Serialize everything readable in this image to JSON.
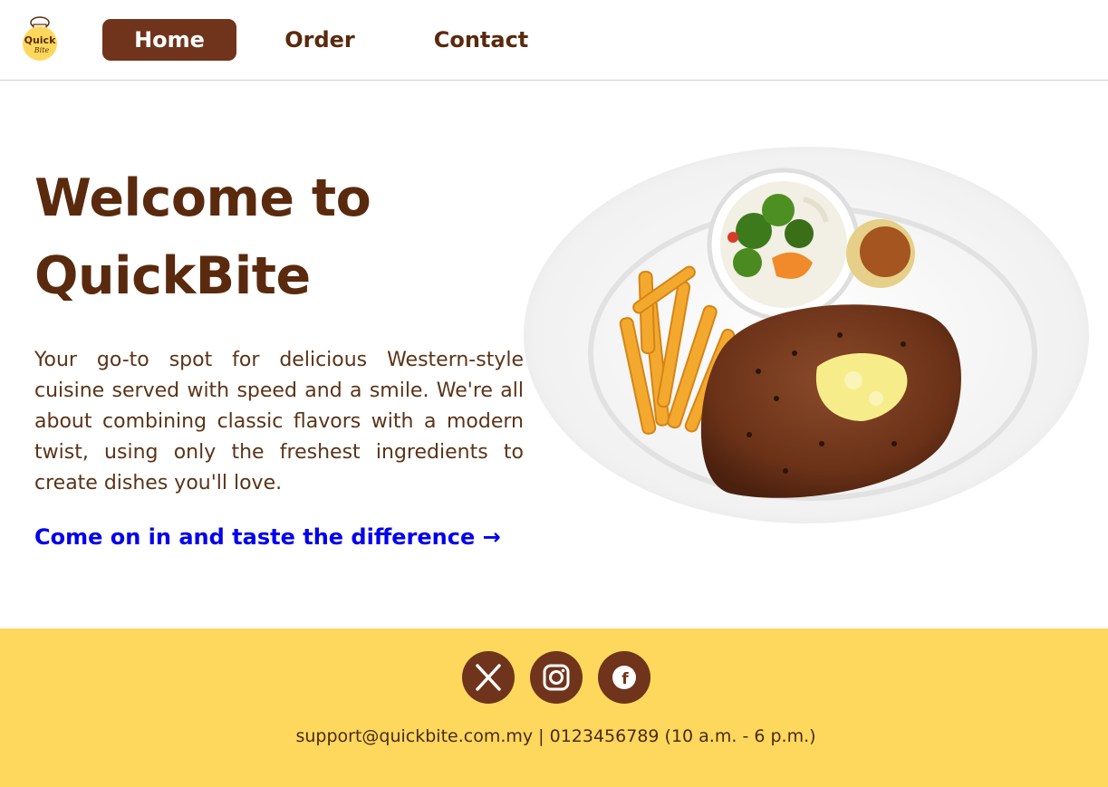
{
  "brand": {
    "logo_text_top": "Quick",
    "logo_text_bottom": "Bite",
    "colors": {
      "brown": "#6f341b",
      "text_brown": "#5a2a0e",
      "yellow": "#fed85d",
      "link": "#0000ee"
    }
  },
  "nav": {
    "items": [
      {
        "label": "Home",
        "active": true
      },
      {
        "label": "Order",
        "active": false
      },
      {
        "label": "Contact",
        "active": false
      }
    ]
  },
  "hero": {
    "title": "Welcome to QuickBite",
    "description": "Your go-to spot for delicious Western-style cuisine served with speed and a smile. We're all about combining classic flavors with a modern twist, using only the freshest ingredients to create dishes you'll love.",
    "cta": "Come on in and taste the difference →",
    "image_icon": "steak-plate-image"
  },
  "footer": {
    "social": [
      {
        "name": "x",
        "icon": "x-logo-icon"
      },
      {
        "name": "instagram",
        "icon": "instagram-icon"
      },
      {
        "name": "facebook",
        "icon": "facebook-icon"
      }
    ],
    "contact": "support@quickbite.com.my | 0123456789 (10 a.m. - 6 p.m.)"
  }
}
